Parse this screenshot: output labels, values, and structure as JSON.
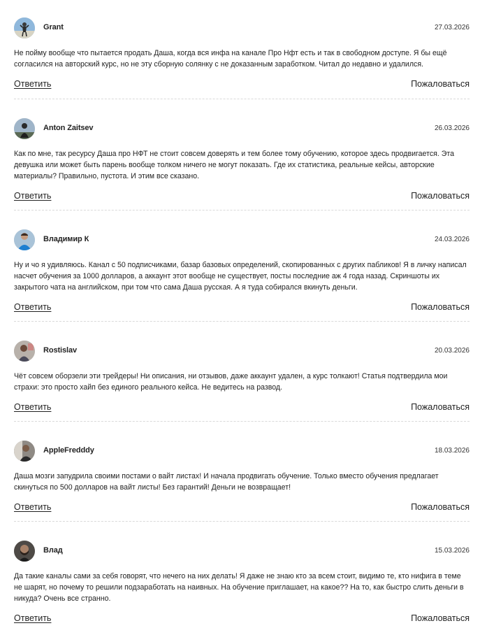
{
  "actions": {
    "reply_label": "Ответить",
    "report_label": "Пожаловаться"
  },
  "comments": [
    {
      "author": "Grant",
      "date": "27.03.2026",
      "text": "Не пойму вообще что пытается продать Даша, когда вся инфа на канале Про Нфт есть и так в свободном доступе. Я бы ещё согласился на авторский курс, но не эту сборную солянку с не доказанным заработком. Читал до недавно и удалился."
    },
    {
      "author": "Anton Zaitsev",
      "date": "26.03.2026",
      "text": "Как по мне, так ресурсу Даша про НФТ не стоит совсем доверять и тем более тому обучению, которое здесь продвигается. Эта девушка или может быть парень вообще толком ничего не могут показать. Где их статистика, реальные кейсы, авторские материалы? Правильно, пустота. И этим все сказано."
    },
    {
      "author": "Владимир К",
      "date": "24.03.2026",
      "text": "Ну и чо я удивляюсь. Канал с 50 подписчиками, базар базовых определений, скопированных с других пабликов! Я в личку написал насчет обучения за 1000 долларов, а аккаунт этот вообще не существует, посты последние аж 4 года назад. Скриншоты их закрытого чата на английском, при том что сама Даша русская. А я туда собирался вкинуть деньги."
    },
    {
      "author": "Rostislav",
      "date": "20.03.2026",
      "text": "Чёт совсем оборзели эти трейдеры! Ни описания, ни отзывов, даже аккаунт удален, а курс толкают! Статья подтвердила мои страхи: это просто хайп без единого реального кейса. Не ведитесь на развод."
    },
    {
      "author": "AppleFredddy",
      "date": "18.03.2026",
      "text": "Даша мозги запудрила своими постами о вайт листах! И начала продвигать обучение. Только вместо обучения предлагает скинуться по 500 долларов на вайт листы! Без гарантий! Деньги не возвращает!"
    },
    {
      "author": "Влад",
      "date": "15.03.2026",
      "text": "Да такие каналы сами за себя говорят, что нечего на них делать! Я даже не знаю кто за всем стоит, видимо те, кто нифига в теме не шарят, но почему то решили подзаработать на наивных. На обучение приглашает, на какое?? На то, как быстро слить деньги в никуда? Очень все странно."
    }
  ]
}
